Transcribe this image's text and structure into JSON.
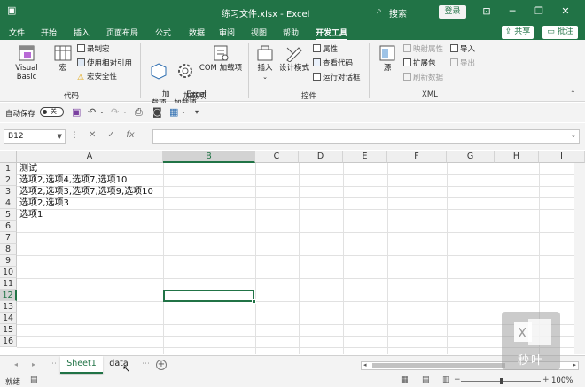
{
  "titlebar": {
    "title": "练习文件.xlsx  -  Excel",
    "search": "搜索",
    "login": "登录"
  },
  "tabs": [
    "文件",
    "开始",
    "插入",
    "页面布局",
    "公式",
    "数据",
    "审阅",
    "视图",
    "帮助",
    "开发工具"
  ],
  "active_tab": "开发工具",
  "share": "共享",
  "comment": "批注",
  "ribbon": {
    "code": {
      "label": "代码",
      "visual_basic": "Visual Basic",
      "macros": "宏",
      "record_macro": "录制宏",
      "relative_ref": "使用相对引用",
      "macro_security": "宏安全性"
    },
    "addins": {
      "label": "加载项",
      "addins": "加\n载项",
      "excel_addins": "Excel\n加载项",
      "com_addins": "COM 加载项"
    },
    "controls": {
      "label": "控件",
      "insert": "插入",
      "design_mode": "设计模式",
      "properties": "属性",
      "view_code": "查看代码",
      "run_dialog": "运行对话框"
    },
    "xml": {
      "label": "XML",
      "source": "源",
      "map_props": "映射属性",
      "expansion_packs": "扩展包",
      "refresh_data": "刷新数据",
      "import": "导入",
      "export": "导出"
    }
  },
  "qat": {
    "autosave": "自动保存",
    "autosave_state": "关"
  },
  "namebox": "B12",
  "formula_value": "",
  "columns": [
    "A",
    "B",
    "C",
    "D",
    "E",
    "F",
    "G",
    "H",
    "I"
  ],
  "selected_column": "B",
  "rows": [
    "1",
    "2",
    "3",
    "4",
    "5",
    "6",
    "7",
    "8",
    "9",
    "10",
    "11",
    "12",
    "13",
    "14",
    "15",
    "16"
  ],
  "selected_row": "12",
  "cells": [
    "测试",
    "选项2,选项4,选项7,选项10",
    "选项2,选项3,选项7,选项9,选项10",
    "选项2,选项3",
    "选项1"
  ],
  "sheets": [
    "Sheet1",
    "data"
  ],
  "active_sheet": "Sheet1",
  "status": {
    "ready": "就绪",
    "zoom": "100%",
    "zoom_level_percent": 100
  },
  "watermark": "秒叶"
}
